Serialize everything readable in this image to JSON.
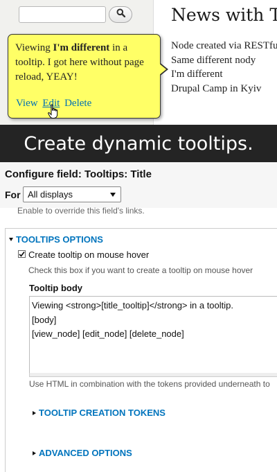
{
  "search": {
    "placeholder": "",
    "button_icon": "search-icon"
  },
  "front": {
    "page_title": "News with Tips",
    "nodes": [
      "Node created via RESTful Service",
      "Same different nody",
      "I'm different",
      "Drupal Camp in Kyiv"
    ]
  },
  "tooltip": {
    "text_before": "Viewing ",
    "text_bold": "I'm different",
    "text_after": " in a tooltip. I got here without page reload, YEAY!",
    "links": {
      "view": "View",
      "edit": "Edit",
      "delete": "Delete"
    },
    "hovered_link": "edit",
    "colors": {
      "background": "#ffff66",
      "link": "#0071b3"
    }
  },
  "banner": {
    "text": "Create dynamic tooltips."
  },
  "config": {
    "title": "Configure field: Tooltips: Title",
    "for_label": "For",
    "display_select": "All displays",
    "override_help": "Enable to override this field's links.",
    "fieldset_legend": "TOOLTIPS OPTIONS",
    "create_tooltip_checkbox": {
      "label": "Create tooltip on mouse hover",
      "checked": true
    },
    "checkbox_description": "Check this box if you want to create a tooltip on mouse hover",
    "body_label": "Tooltip body",
    "body_value": "Viewing <strong>[title_tooltip]</strong> in a tooltip.\n[body]\n[view_node] [edit_node] [delete_node]",
    "body_help": "Use HTML in combination with the tokens provided underneath to",
    "tokens_toggle": "TOOLTIP CREATION TOKENS",
    "advanced_toggle": "ADVANCED OPTIONS",
    "colors": {
      "accent": "#0074bd",
      "banner_bg": "#242424"
    }
  }
}
